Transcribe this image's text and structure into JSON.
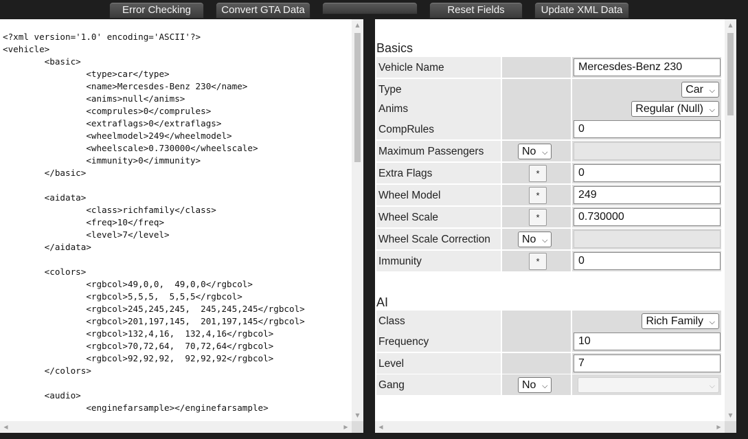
{
  "toolbar": {
    "error_checking": "Error Checking",
    "convert_gta": "Convert GTA Data",
    "blank": "",
    "reset_fields": "Reset Fields",
    "update_xml": "Update XML Data"
  },
  "xml_lines": [
    "<?xml version='1.0' encoding='ASCII'?>",
    "<vehicle>",
    "        <basic>",
    "                <type>car</type>",
    "                <name>Mercesdes-Benz 230</name>",
    "                <anims>null</anims>",
    "                <comprules>0</comprules>",
    "                <extraflags>0</extraflags>",
    "                <wheelmodel>249</wheelmodel>",
    "                <wheelscale>0.730000</wheelscale>",
    "                <immunity>0</immunity>",
    "        </basic>",
    "",
    "        <aidata>",
    "                <class>richfamily</class>",
    "                <freq>10</freq>",
    "                <level>7</level>",
    "        </aidata>",
    "",
    "        <colors>",
    "                <rgbcol>49,0,0,  49,0,0</rgbcol>",
    "                <rgbcol>5,5,5,  5,5,5</rgbcol>",
    "                <rgbcol>245,245,245,  245,245,245</rgbcol>",
    "                <rgbcol>201,197,145,  201,197,145</rgbcol>",
    "                <rgbcol>132,4,16,  132,4,16</rgbcol>",
    "                <rgbcol>70,72,64,  70,72,64</rgbcol>",
    "                <rgbcol>92,92,92,  92,92,92</rgbcol>",
    "        </colors>",
    "",
    "        <audio>",
    "                <enginefarsample></enginefarsample>"
  ],
  "basics": {
    "title": "Basics",
    "vehicle_name": {
      "label": "Vehicle Name",
      "value": "Mercesdes-Benz 230"
    },
    "type": {
      "label": "Type",
      "selected": "Car"
    },
    "anims": {
      "label": "Anims",
      "selected": "Regular (Null)"
    },
    "comprules": {
      "label": "CompRules",
      "value": "0"
    },
    "max_passengers": {
      "label": "Maximum Passengers",
      "selected": "No"
    },
    "extra_flags": {
      "label": "Extra Flags",
      "star": "*",
      "value": "0"
    },
    "wheel_model": {
      "label": "Wheel Model",
      "star": "*",
      "value": "249"
    },
    "wheel_scale": {
      "label": "Wheel Scale",
      "star": "*",
      "value": "0.730000"
    },
    "wheel_scale_correction": {
      "label": "Wheel Scale Correction",
      "selected": "No"
    },
    "immunity": {
      "label": "Immunity",
      "star": "*",
      "value": "0"
    }
  },
  "ai": {
    "title": "AI",
    "class": {
      "label": "Class",
      "selected": "Rich Family"
    },
    "frequency": {
      "label": "Frequency",
      "value": "10"
    },
    "level": {
      "label": "Level",
      "value": "7"
    },
    "gang": {
      "label": "Gang",
      "selected": "No"
    }
  }
}
